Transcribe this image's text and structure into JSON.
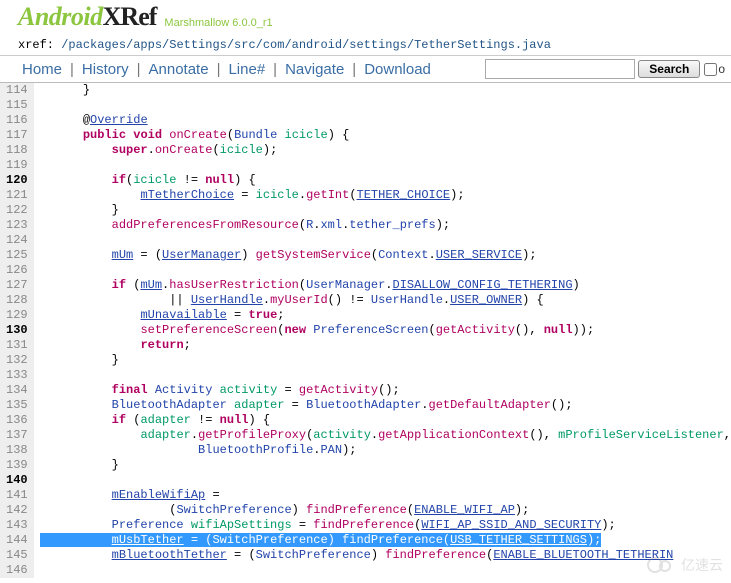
{
  "brand": {
    "a": "Android",
    "x": "XRef",
    "version": "Marshmallow 6.0.0_r1"
  },
  "xref": {
    "prefix": "xref: ",
    "path": "/packages/apps/Settings/src/com/android/settings/TetherSettings.java"
  },
  "nav": {
    "home": "Home",
    "history": "History",
    "annotate": "Annotate",
    "line": "Line#",
    "navigate": "Navigate",
    "download": "Download",
    "search_btn": "Search",
    "full": "o"
  },
  "search": {
    "placeholder": ""
  },
  "watermark": "亿速云",
  "lines": {
    "l114": "      }",
    "l115": "",
    "l116": "      @<idu>Override</idu>",
    "l117": "      <kw>public</kw> <kw>void</kw> <fn>onCreate</fn>(<id>Bundle</id> <ct>icicle</ct>) {",
    "l118": "          <kw>super</kw>.<fn>onCreate</fn>(<ct>icicle</ct>);",
    "l119": "",
    "l120": "          <kw>if</kw>(<ct>icicle</ct> != <kw>null</kw>) {",
    "l121": "              <idu>mTetherChoice</idu> = <ct>icicle</ct>.<fn>getInt</fn>(<idu>TETHER_CHOICE</idu>);",
    "l122": "          }",
    "l123": "          <fn>addPreferencesFromResource</fn>(<id>R</id>.<id>xml</id>.<id>tether_prefs</id>);",
    "l124": "",
    "l125": "          <idu>mUm</idu> = (<idu>UserManager</idu>) <fn>getSystemService</fn>(<id>Context</id>.<idu>USER_SERVICE</idu>);",
    "l126": "",
    "l127": "          <kw>if</kw> (<idu>mUm</idu>.<fn>hasUserRestriction</fn>(<id>UserManager</id>.<idu>DISALLOW_CONFIG_TETHERING</idu>)",
    "l128": "                  || <idu>UserHandle</idu>.<fn>myUserId</fn>() != <id>UserHandle</id>.<idu>USER_OWNER</idu>) {",
    "l129": "              <idu>mUnavailable</idu> = <kw>true</kw>;",
    "l130": "              <fn>setPreferenceScreen</fn>(<kw>new</kw> <id>PreferenceScreen</id>(<fn>getActivity</fn>(), <kw>null</kw>));",
    "l131": "              <kw>return</kw>;",
    "l132": "          }",
    "l133": "",
    "l134": "          <kw>final</kw> <id>Activity</id> <ct>activity</ct> = <fn>getActivity</fn>();",
    "l135": "          <id>BluetoothAdapter</id> <ct>adapter</ct> = <id>BluetoothAdapter</id>.<fn>getDefaultAdapter</fn>();",
    "l136": "          <kw>if</kw> (<ct>adapter</ct> != <kw>null</kw>) {",
    "l137": "              <ct>adapter</ct>.<fn>getProfileProxy</fn>(<ct>activity</ct>.<fn>getApplicationContext</fn>(), <ct>mProfileServiceListener</ct>,",
    "l138": "                      <id>BluetoothProfile</id>.<id>PAN</id>);",
    "l139": "          }",
    "l140": "",
    "l141": "          <idu>mEnableWifiAp</idu> =",
    "l142": "                  (<id>SwitchPreference</id>) <fn>findPreference</fn>(<idu>ENABLE_WIFI_AP</idu>);",
    "l143": "          <id>Preference</id> <ct>wifiApSettings</ct> = <fn>findPreference</fn>(<idu>WIFI_AP_SSID_AND_SECURITY</idu>);",
    "l144": "<hl>          <idu>mUsbTether</idu> = (<id>SwitchPreference</id>) <fn>findPreference</fn>(<idu>USB_TETHER_SETTINGS</idu>);</hl>",
    "l145": "          <idu>mBluetoothTether</idu> = (<id>SwitchPreference</id>) <fn>findPreference</fn>(<idu>ENABLE_BLUETOOTH_TETHERIN</idu>",
    "l146": ""
  },
  "bold_lines": [
    "120",
    "130",
    "140"
  ]
}
